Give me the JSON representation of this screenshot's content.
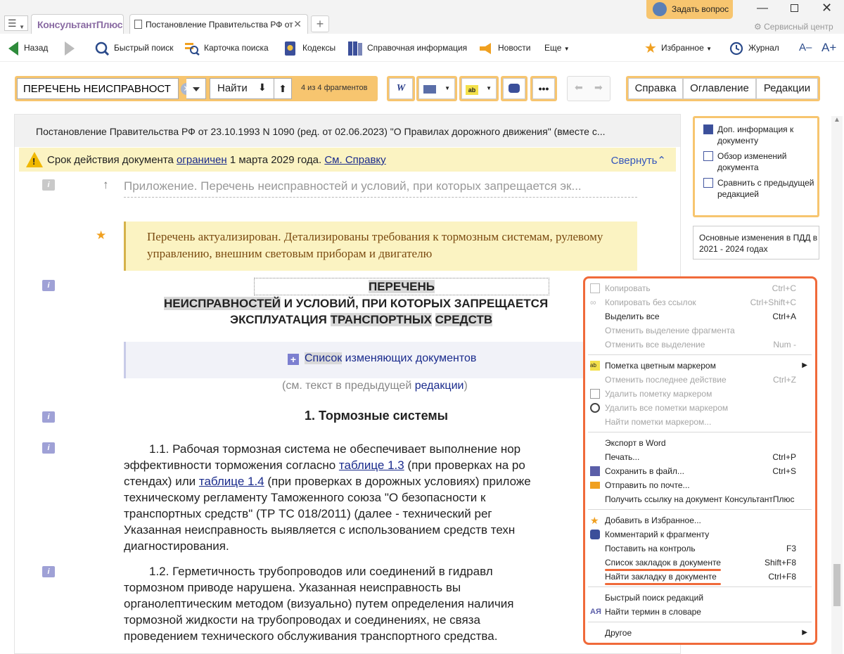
{
  "window": {
    "logo": "КонсультантПлюс",
    "tab_title": "Постановление Правительства РФ от",
    "ask_button": "Задать вопрос",
    "service_center": "Сервисный центр"
  },
  "toolbar": {
    "back": "Назад",
    "quick_search": "Быстрый поиск",
    "search_card": "Карточка поиска",
    "codes": "Кодексы",
    "reference": "Справочная информация",
    "news": "Новости",
    "more": "Еще",
    "favorites": "Избранное",
    "journal": "Журнал",
    "font_minus": "A–",
    "font_plus": "A+"
  },
  "search": {
    "value": "ПЕРЕЧЕНЬ НЕИСПРАВНОСТ",
    "find_label": "Найти",
    "count": "4 из 4 фрагментов"
  },
  "right_tabs": [
    "Справка",
    "Оглавление",
    "Редакции"
  ],
  "document": {
    "header": "Постановление Правительства РФ от 23.10.1993 N 1090 (ред. от 02.06.2023) \"О Правилах дорожного движения\" (вместе с...",
    "warning_prefix": "Срок действия документа",
    "warning_link": "ограничен",
    "warning_date": "1 марта 2029 года.",
    "warning_ref": "См. Справку",
    "collapse": "Свернуть",
    "appendix_line": "Приложение. Перечень неисправностей и условий, при которых запрещается эк...",
    "note": "Перечень актуализирован. Детализированы требования к тормозным системам, рулевому управлению, внешним световым приборам и двигателю",
    "title_1": "ПЕРЕЧЕНЬ",
    "title_2a": "НЕИСПРАВНОСТЕЙ",
    "title_2b": " И УСЛОВИЙ, ПРИ КОТОРЫХ ЗАПРЕЩАЕТСЯ",
    "title_3a": "ЭКСПЛУАТАЦИЯ ",
    "title_3b": "ТРАНСПОРТНЫХ",
    "title_3c": " ",
    "title_3d": "СРЕДСТВ",
    "changing_a": "Список",
    "changing_b": " изменяющих документов",
    "see_text": "(см. текст в предыдущей ",
    "see_link": "редакции",
    "see_end": ")",
    "section_1": "1. Тормозные системы",
    "p11_a": "1.1. Рабочая тормозная система не обеспечивает выполнение нор",
    "p11_b": "эффективности торможения согласно ",
    "p11_link1": "таблице 1.3",
    "p11_c": " (при проверках на ро",
    "p11_d": "стендах) или ",
    "p11_link2": "таблице 1.4",
    "p11_e": " (при проверках в дорожных условиях) приложе",
    "p11_f": "техническому регламенту Таможенного союза \"О безопасности к",
    "p11_g": "транспортных средств\" (ТР ТС 018/2011) (далее - технический рег",
    "p11_h": "Указанная неисправность выявляется с использованием средств техн",
    "p11_i": "диагностирования.",
    "p12_a": "1.2. Герметичность трубопроводов или соединений в гидравл",
    "p12_b": "тормозном приводе нарушена. Указанная неисправность вы",
    "p12_c": "органолептическим методом (визуально) путем определения наличия",
    "p12_d": "тормозной жидкости на трубопроводах и соединениях, не связа",
    "p12_e": "проведением технического обслуживания транспортного средства."
  },
  "side_panel": {
    "item1": "Доп. информация к документу",
    "item2": "Обзор изменений документа",
    "item3": "Сравнить с предыдущей редакцией",
    "changes": "Основные изменения в ПДД в 2021 - 2024 годах"
  },
  "context_menu": {
    "items": [
      {
        "label": "Копировать",
        "shortcut": "Ctrl+C",
        "disabled": true
      },
      {
        "label": "Копировать без ссылок",
        "shortcut": "Ctrl+Shift+C",
        "disabled": true
      },
      {
        "label": "Выделить все",
        "shortcut": "Ctrl+A",
        "disabled": false
      },
      {
        "label": "Отменить выделение фрагмента",
        "shortcut": "",
        "disabled": true
      },
      {
        "label": "Отменить все выделение",
        "shortcut": "Num -",
        "disabled": true
      },
      {
        "label": "Пометка цветным маркером",
        "shortcut": "",
        "disabled": false
      },
      {
        "label": "Отменить последнее действие",
        "shortcut": "Ctrl+Z",
        "disabled": true
      },
      {
        "label": "Удалить пометку маркером",
        "shortcut": "",
        "disabled": true
      },
      {
        "label": "Удалить все пометки маркером",
        "shortcut": "",
        "disabled": true
      },
      {
        "label": "Найти пометки маркером...",
        "shortcut": "",
        "disabled": true
      },
      {
        "label": "Экспорт в Word",
        "shortcut": "",
        "disabled": false
      },
      {
        "label": "Печать...",
        "shortcut": "Ctrl+P",
        "disabled": false
      },
      {
        "label": "Сохранить в файл...",
        "shortcut": "Ctrl+S",
        "disabled": false
      },
      {
        "label": "Отправить по почте...",
        "shortcut": "",
        "disabled": false
      },
      {
        "label": "Получить ссылку на документ КонсультантПлюс",
        "shortcut": "",
        "disabled": false
      },
      {
        "label": "Добавить в Избранное...",
        "shortcut": "",
        "disabled": false
      },
      {
        "label": "Комментарий к фрагменту",
        "shortcut": "",
        "disabled": false
      },
      {
        "label": "Поставить на контроль",
        "shortcut": "F3",
        "disabled": false
      },
      {
        "label": "Список закладок в документе",
        "shortcut": "Shift+F8",
        "disabled": false
      },
      {
        "label": "Найти закладку в документе",
        "shortcut": "Ctrl+F8",
        "disabled": false
      },
      {
        "label": "Быстрый поиск редакций",
        "shortcut": "",
        "disabled": false
      },
      {
        "label": "Найти термин в словаре",
        "shortcut": "",
        "disabled": false
      },
      {
        "label": "Другое",
        "shortcut": "",
        "disabled": false
      }
    ]
  },
  "colors": {
    "accent": "#f7c56f",
    "highlight": "#f06a3a",
    "link": "#1a2b8c"
  }
}
